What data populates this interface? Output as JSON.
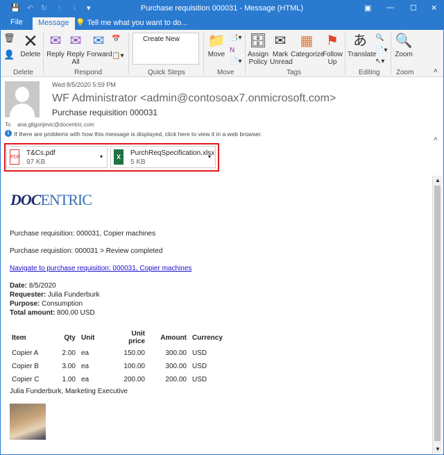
{
  "window": {
    "title": "Purchase requisition 000031 - Message (HTML)"
  },
  "tabs": {
    "file": "File",
    "message": "Message",
    "tell_me": "Tell me what you want to do..."
  },
  "ribbon": {
    "delete_label": "Delete",
    "reply": "Reply",
    "reply_all": "Reply All",
    "forward": "Forward",
    "create_new": "Create New",
    "move": "Move",
    "assign_policy": "Assign Policy",
    "mark_unread": "Mark Unread",
    "categorize": "Categorize",
    "follow_up": "Follow Up",
    "translate": "Translate",
    "zoom": "Zoom",
    "groups": [
      "Delete",
      "Respond",
      "Quick Steps",
      "Move",
      "Tags",
      "Editing",
      "Zoom"
    ]
  },
  "message": {
    "date": "Wed 8/5/2020 5:59 PM",
    "from": "WF Administrator <admin@contosoax7.onmicrosoft.com>",
    "subject": "Purchase requisition 000031",
    "to_label": "To",
    "to": "ana.gligorijevic@docentric.com",
    "info": "If there are problems with how this message is displayed, click here to view it in a web browser."
  },
  "attachments": [
    {
      "name": "T&Cs.pdf",
      "size": "97 KB"
    },
    {
      "name": "PurchReqSpecification.xlsx",
      "size": "5 KB"
    }
  ],
  "body": {
    "logo": "DOCENTRIC",
    "line1": "Purchase requisition: 000031, Copier machines",
    "line2": "Purchase requistion: 000031 > Review completed",
    "link": "Navigate to purchase requisition: 000031, Copier machines",
    "date_label": "Date:",
    "date": "8/5/2020",
    "requester_label": "Requester:",
    "requester": "Julia Funderburk",
    "purpose_label": "Purpose:",
    "purpose": "Consumption",
    "total_label": "Total amount:",
    "total": "800.00 USD",
    "headers": [
      "Item",
      "Qty",
      "Unit",
      "Unit price",
      "Amount",
      "Currency"
    ],
    "rows": [
      [
        "Copier A",
        "2.00",
        "ea",
        "150.00",
        "300.00",
        "USD"
      ],
      [
        "Copier B",
        "3.00",
        "ea",
        "100.00",
        "300.00",
        "USD"
      ],
      [
        "Copier C",
        "1.00",
        "ea",
        "200.00",
        "200.00",
        "USD"
      ]
    ],
    "signature": "Julia Funderburk, Marketing Executive"
  }
}
